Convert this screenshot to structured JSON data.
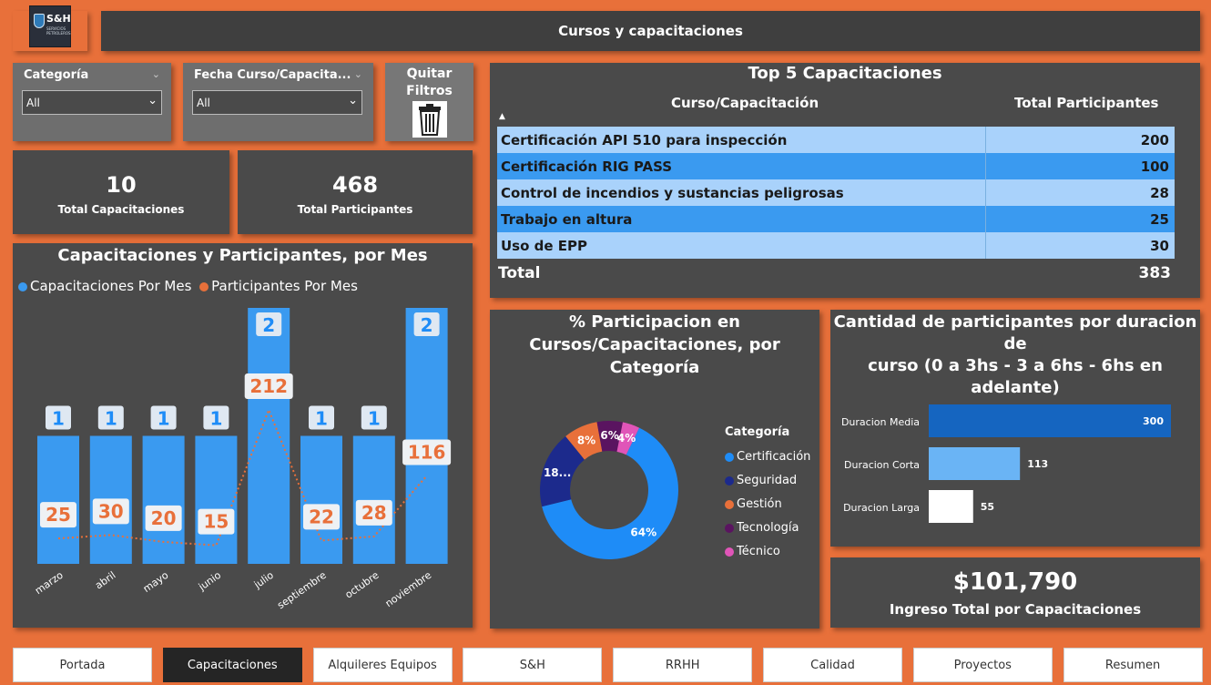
{
  "header": {
    "title": "Cursos y capacitaciones",
    "logo_text": "S&H",
    "logo_subtext": "SERVICIOS PETROLEROS"
  },
  "slicers": [
    {
      "label": "Categoría",
      "value": "All"
    },
    {
      "label": "Fecha Curso/Capacita...",
      "value": "All"
    }
  ],
  "clear_filters": {
    "label_line1": "Quitar",
    "label_line2": "Filtros",
    "icon": "trash-icon"
  },
  "kpis": {
    "capacitaciones": {
      "value": "10",
      "label": "Total Capacitaciones"
    },
    "participantes": {
      "value": "468",
      "label": "Total Participantes"
    },
    "ingreso": {
      "value": "$101,790",
      "label": "Ingreso Total por Capacitaciones"
    }
  },
  "top5": {
    "title": "Top 5 Capacitaciones",
    "col1": "Curso/Capacitación",
    "col2": "Total Participantes",
    "rows": [
      {
        "name": "Certificación API 510 para inspección",
        "value": "200"
      },
      {
        "name": "Certificación RIG PASS",
        "value": "100"
      },
      {
        "name": "Control de incendios y sustancias peligrosas",
        "value": "28"
      },
      {
        "name": "Trabajo en altura",
        "value": "25"
      },
      {
        "name": "Uso de EPP",
        "value": "30"
      }
    ],
    "total_label": "Total",
    "total_value": "383"
  },
  "colors": {
    "orange": "#e8703a",
    "blue": "#3a9af0",
    "dark": "#4a4a4a"
  },
  "nav": {
    "tabs": [
      "Portada",
      "Capacitaciones",
      "Alquileres Equipos",
      "S&H",
      "RRHH",
      "Calidad",
      "Proyectos",
      "Resumen"
    ],
    "active": "Capacitaciones"
  },
  "chart_data": [
    {
      "type": "bar",
      "title": "Capacitaciones y Participantes, por Mes",
      "categories": [
        "marzo",
        "abril",
        "mayo",
        "junio",
        "julio",
        "septiembre",
        "octubre",
        "noviembre"
      ],
      "series": [
        {
          "name": "Capacitaciones Por Mes",
          "values": [
            1,
            1,
            1,
            1,
            2,
            1,
            1,
            2
          ],
          "color": "#3a9af0"
        },
        {
          "name": "Participantes Por Mes",
          "values": [
            25,
            30,
            20,
            15,
            212,
            22,
            28,
            116
          ],
          "color": "#e8703a"
        }
      ]
    },
    {
      "type": "pie",
      "title_line1": "% Participacion en",
      "title_line2": "Cursos/Capacitaciones, por Categoría",
      "legend_title": "Categoría",
      "slices": [
        {
          "name": "Certificación",
          "percent": 64,
          "label": "64%",
          "color": "#1e8cf7"
        },
        {
          "name": "Seguridad",
          "percent": 18,
          "label": "18...",
          "color": "#1c2a8c"
        },
        {
          "name": "Gestión",
          "percent": 8,
          "label": "8%",
          "color": "#e8703a"
        },
        {
          "name": "Tecnología",
          "percent": 6,
          "label": "6%",
          "color": "#5a1460"
        },
        {
          "name": "Técnico",
          "percent": 4,
          "label": "4%",
          "color": "#e055b8"
        }
      ]
    },
    {
      "type": "bar",
      "orientation": "horizontal",
      "title_line1": "Cantidad de participantes por duracion de",
      "title_line2": "curso (0 a 3hs - 3 a 6hs - 6hs en",
      "title_line3": "adelante)",
      "categories": [
        "Duracion Media",
        "Duracion Corta",
        "Duracion Larga"
      ],
      "values": [
        300,
        113,
        55
      ],
      "colors": [
        "#1565c0",
        "#6ab4f5",
        "#ffffff"
      ]
    }
  ]
}
